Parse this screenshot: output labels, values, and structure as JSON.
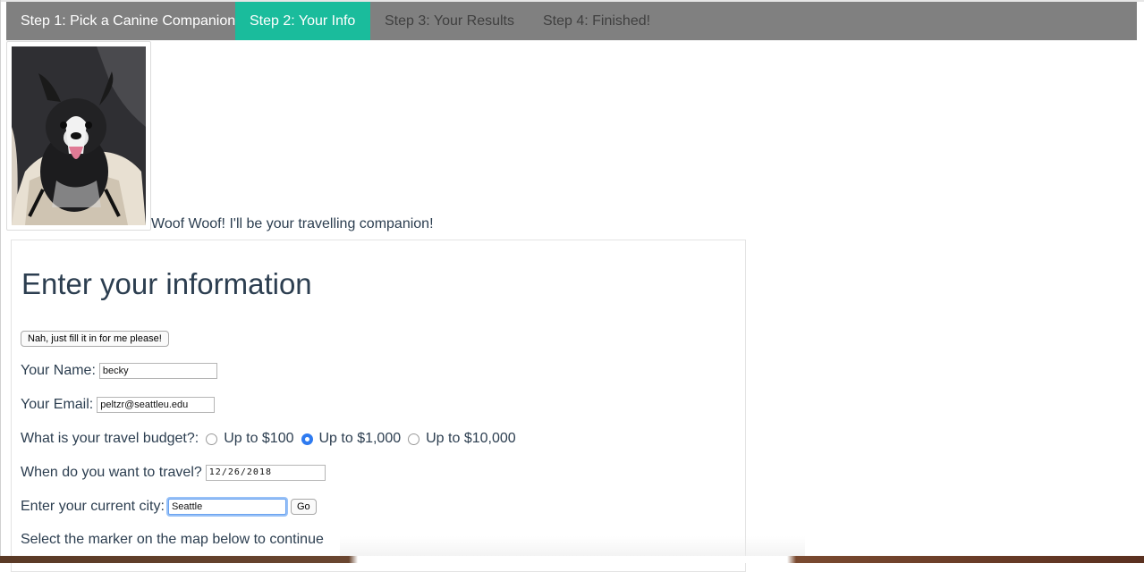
{
  "nav": {
    "steps": [
      {
        "label": "Step 1: Pick a Canine Companion",
        "state": "normal"
      },
      {
        "label": "Step 2: Your Info",
        "state": "active"
      },
      {
        "label": "Step 3: Your Results",
        "state": "dim"
      },
      {
        "label": "Step 4: Finished!",
        "state": "dim"
      }
    ],
    "active_color": "#1abc9c",
    "bar_color": "#808080"
  },
  "companion": {
    "caption": "Woof Woof! I'll be your travelling companion!"
  },
  "form": {
    "heading": "Enter your information",
    "autofill_label": "Nah, just fill it in for me please!",
    "name_label": "Your Name:",
    "name_value": "becky",
    "email_label": "Your Email:",
    "email_value": "peltzr@seattleu.edu",
    "budget_label": "What is your travel budget?:",
    "budget_options": [
      "Up to $100",
      "Up to $1,000",
      "Up to $10,000"
    ],
    "budget_selected": "Up to $1,000",
    "date_label": "When do you want to travel?",
    "date_value": "12/26/2018",
    "city_label": "Enter your current city:",
    "city_value": "Seattle",
    "go_label": "Go",
    "map_instruction": "Select the marker on the map below to continue"
  }
}
